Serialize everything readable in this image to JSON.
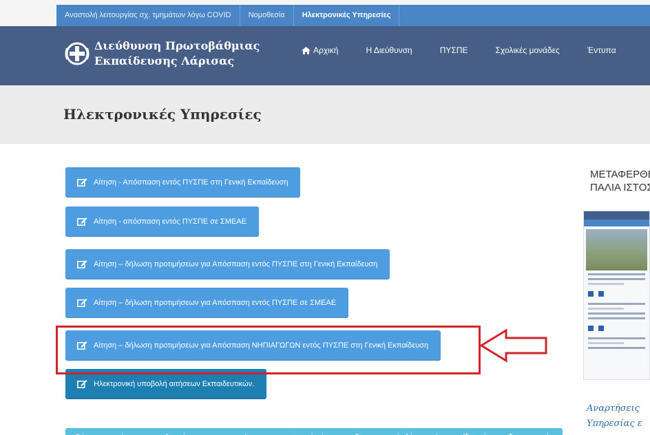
{
  "topbar": {
    "links": [
      "Αναστολή λειτουργίας σχ. τμημάτων λόγω COVID",
      "Νομοθεσία",
      "Ηλεκτρονικές Υπηρεσίες"
    ]
  },
  "header": {
    "brand_line1": "Διεύθυνση Πρωτοβάθμιας",
    "brand_line2": "Εκπαίδευσης Λάρισας",
    "nav": [
      "Αρχική",
      "Η Διεύθυνση",
      "ΠΥΣΠΕ",
      "Σχολικές μονάδες",
      "Έντυπα"
    ]
  },
  "page_title": "Ηλεκτρονικές Υπηρεσίες",
  "services": [
    "Αίτηση - Απόσπαση εντός ΠΥΣΠΕ στη Γενική Εκπαίδευση",
    "Αίτηση - απόσπαση εντός ΠΥΣΠΕ σε ΣΜΕΑΕ",
    "Αίτηση – δήλωση προτιμήσεων για Απόσπαση εντός ΠΥΣΠΕ στη Γενική Εκπαίδευση",
    "Αίτηση – δήλωση προτιμήσεων για Απόσπαση εντός ΠΥΣΠΕ σε ΣΜΕΑΕ",
    "Αίτηση – δήλωση προτιμήσεων για Απόσπαση ΝΗΠΙΑΓΩΓΩΝ εντός ΠΥΣΠΕ στη Γενική Εκπαίδευση",
    "Ηλεκτρονική υποβολή αιτήσεων Εκπαιδευτικών.",
    "Φόρμα καταχώρισης αποτελεσμάτων της εφαρμογής του υποχρεωτικού μέτρου του διαγνωστικού ελέγχου νόσησης (δωρεάν αυτοδιαγνωστικός έλεγχος)."
  ],
  "sidebar": {
    "heading_line1": "ΜΕΤΑΦΕΡΘΕΙ",
    "heading_line2": "ΠΑΛΙΑ ΙΣΤΟΣ",
    "script_line1": "Αναρτήσεις",
    "script_line2": "Υπηρεσίας ε"
  },
  "icons": {
    "home": "home-icon",
    "edit": "edit-icon",
    "arrow": "left-arrow-annotation"
  },
  "colors": {
    "header": "#475f86",
    "topbar": "#4a86c6",
    "button": "#4d9de0",
    "button_dark": "#1e7fb3",
    "button_teal": "#5bc0de",
    "highlight": "#d1232b"
  }
}
